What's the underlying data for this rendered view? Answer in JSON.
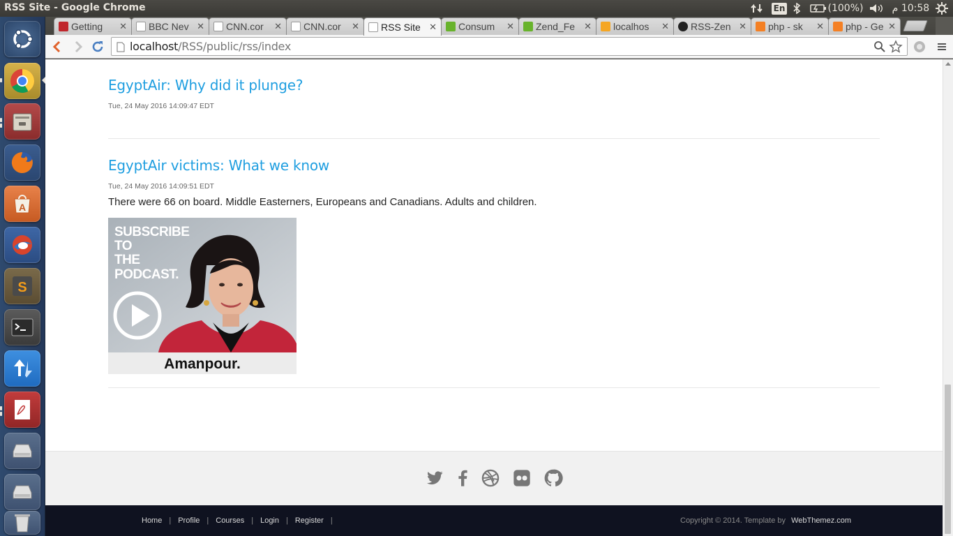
{
  "system": {
    "window_title": "RSS Site - Google Chrome",
    "keyboard_layout": "En",
    "battery": "(100%)",
    "clock_ampm": "م",
    "clock": "10:58"
  },
  "launcher": {
    "items": [
      "ubuntu-dash",
      "chrome",
      "files",
      "firefox",
      "software-center",
      "thunderbird",
      "sublime-text",
      "terminal",
      "updater",
      "document-viewer",
      "drive",
      "drive",
      "trash"
    ]
  },
  "browser": {
    "tabs": [
      {
        "label": "Getting",
        "favicon_color": "#c0262c"
      },
      {
        "label": "BBC Nev",
        "favicon_color": "#ffffff"
      },
      {
        "label": "CNN.cor",
        "favicon_color": "#ffffff"
      },
      {
        "label": "CNN.cor",
        "favicon_color": "#ffffff"
      },
      {
        "label": "RSS Site",
        "favicon_color": "#ffffff"
      },
      {
        "label": "Consum",
        "favicon_color": "#68b32c"
      },
      {
        "label": "Zend_Fe",
        "favicon_color": "#68b32c"
      },
      {
        "label": "localhos",
        "favicon_color": "#f5a623"
      },
      {
        "label": "RSS-Zen",
        "favicon_color": "#222222"
      },
      {
        "label": "php - sk",
        "favicon_color": "#f48024"
      },
      {
        "label": "php - Ge",
        "favicon_color": "#f48024"
      }
    ],
    "url_host": "localhost",
    "url_path": "/RSS/public/rss/index"
  },
  "page": {
    "posts": [
      {
        "title": "EgyptAir: Why did it plunge?",
        "date": "Tue, 24 May 2016 14:09:47 EDT",
        "description": ""
      },
      {
        "title": "EgyptAir victims: What we know",
        "date": "Tue, 24 May 2016 14:09:51 EDT",
        "description": "There were 66 on board. Middle Easterners, Europeans and Canadians. Adults and children."
      }
    ],
    "podcast_image": {
      "line1": "SUBSCRIBE",
      "line2": "TO",
      "line3": "THE",
      "line4": "PODCAST.",
      "name": "Amanpour."
    },
    "social_icons": [
      "twitter-icon",
      "facebook-icon",
      "dribbble-icon",
      "flickr-icon",
      "github-icon"
    ],
    "footer": {
      "links": [
        "Home",
        "Profile",
        "Courses",
        "Login",
        "Register"
      ],
      "copyright": "Copyright © 2014. Template by",
      "credit": "WebThemez.com"
    }
  },
  "colors": {
    "link": "#1e9ee0",
    "footer_dark": "#0f1220",
    "footer_light": "#f1f1f1"
  }
}
